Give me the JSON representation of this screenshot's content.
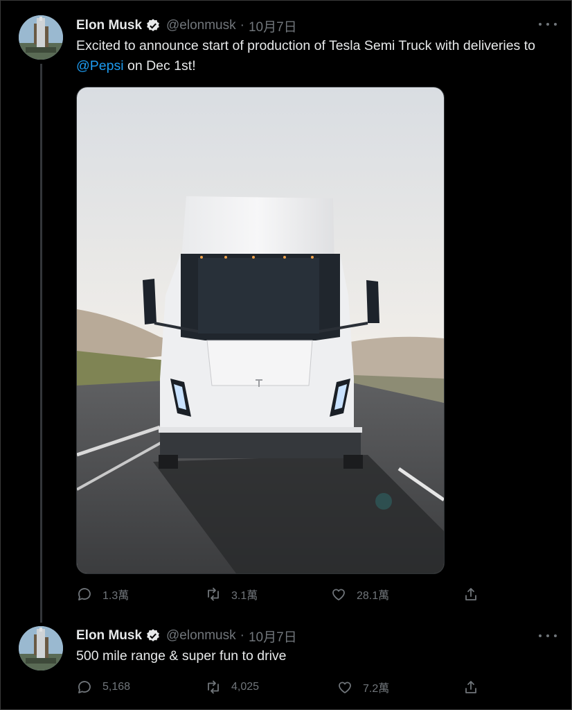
{
  "colors": {
    "background": "#000000",
    "text": "#e7e9ea",
    "muted": "#71767b",
    "link": "#1d9bf0",
    "verified_badge": "#e7e9ea"
  },
  "tweets": [
    {
      "author": {
        "name": "Elon Musk",
        "handle": "@elonmusk",
        "verified_icon": "verified-badge-icon"
      },
      "separator": "·",
      "timestamp": "10月7日",
      "text_before": "Excited to announce start of production of Tesla Semi Truck with deliveries to ",
      "mention": "@Pepsi",
      "text_after": " on Dec 1st!",
      "media": {
        "icon": "tesla-semi-truck-photo"
      },
      "actions": {
        "reply_count": "1.3萬",
        "retweet_count": "3.1萬",
        "like_count": "28.1萬",
        "share_icon": "share-icon"
      }
    },
    {
      "author": {
        "name": "Elon Musk",
        "handle": "@elonmusk",
        "verified_icon": "verified-badge-icon"
      },
      "separator": "·",
      "timestamp": "10月7日",
      "text": "500 mile range & super fun to drive",
      "actions": {
        "reply_count": "5,168",
        "retweet_count": "4,025",
        "like_count": "7.2萬",
        "share_icon": "share-icon"
      }
    }
  ]
}
